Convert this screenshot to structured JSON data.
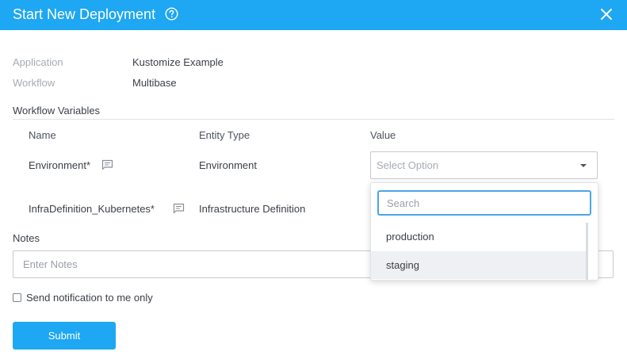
{
  "header": {
    "title": "Start New Deployment",
    "help_icon": "help-circle-icon",
    "close_icon": "close-icon",
    "background": "#1ea7f2"
  },
  "meta": [
    {
      "label": "Application",
      "value": "Kustomize Example"
    },
    {
      "label": "Workflow",
      "value": "Multibase"
    }
  ],
  "workflow_variables": {
    "title": "Workflow Variables",
    "columns": [
      "Name",
      "Entity Type",
      "Value"
    ],
    "rows": [
      {
        "name": "Environment*",
        "entity_type": "Environment",
        "value_placeholder": "Select Option",
        "note_icon": "comment-icon"
      },
      {
        "name": "InfraDefinition_Kubernetes*",
        "entity_type": "Infrastructure Definition",
        "note_icon": "comment-icon"
      }
    ]
  },
  "dropdown": {
    "search_placeholder": "Search",
    "options": [
      "production",
      "staging"
    ],
    "highlighted_option": "staging"
  },
  "notes": {
    "label": "Notes",
    "placeholder": "Enter Notes"
  },
  "notify": {
    "label": "Send notification to me only",
    "checked": false
  },
  "submit": {
    "label": "Submit"
  }
}
